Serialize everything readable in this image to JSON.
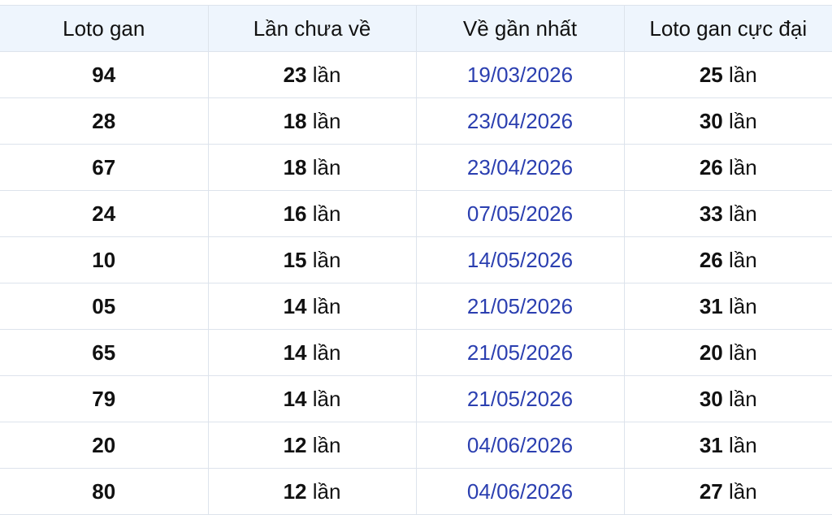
{
  "table": {
    "headers": [
      "Loto gan",
      "Lần chưa về",
      "Về gần nhất",
      "Loto gan cực đại"
    ],
    "unit": "lần",
    "rows": [
      {
        "loto": "94",
        "absent": "23",
        "last": "19/03/2026",
        "max": "25"
      },
      {
        "loto": "28",
        "absent": "18",
        "last": "23/04/2026",
        "max": "30"
      },
      {
        "loto": "67",
        "absent": "18",
        "last": "23/04/2026",
        "max": "26"
      },
      {
        "loto": "24",
        "absent": "16",
        "last": "07/05/2026",
        "max": "33"
      },
      {
        "loto": "10",
        "absent": "15",
        "last": "14/05/2026",
        "max": "26"
      },
      {
        "loto": "05",
        "absent": "14",
        "last": "21/05/2026",
        "max": "31"
      },
      {
        "loto": "65",
        "absent": "14",
        "last": "21/05/2026",
        "max": "20"
      },
      {
        "loto": "79",
        "absent": "14",
        "last": "21/05/2026",
        "max": "30"
      },
      {
        "loto": "20",
        "absent": "12",
        "last": "04/06/2026",
        "max": "31"
      },
      {
        "loto": "80",
        "absent": "12",
        "last": "04/06/2026",
        "max": "27"
      }
    ]
  },
  "colors": {
    "header_bg": "#eef5fd",
    "date_text": "#2b3fb0",
    "border": "#dde3ec"
  }
}
